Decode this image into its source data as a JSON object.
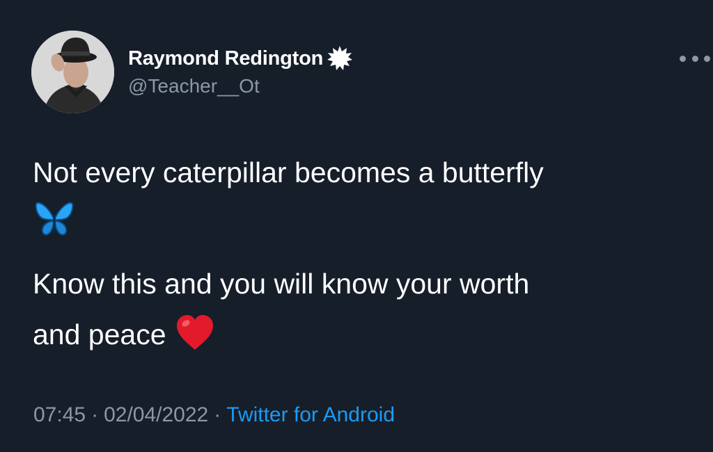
{
  "user": {
    "display_name": "Raymond Redington",
    "handle": "@Teacher__Ot",
    "verified_icon": "verified-badge-icon"
  },
  "menu": {
    "icon": "more-options-icon"
  },
  "tweet": {
    "line1": "Not every caterpillar becomes a butterfly",
    "emoji1": "butterfly-emoji",
    "line2": "Know this and you will know your worth",
    "line3": "and peace",
    "emoji2": "red-heart-emoji"
  },
  "meta": {
    "time": "07:45",
    "separator": "·",
    "date": "02/04/2022",
    "source": "Twitter for Android"
  },
  "colors": {
    "background": "#15202b",
    "text": "#ffffff",
    "secondary_text": "#8b98a5",
    "link": "#1d9bf0"
  }
}
